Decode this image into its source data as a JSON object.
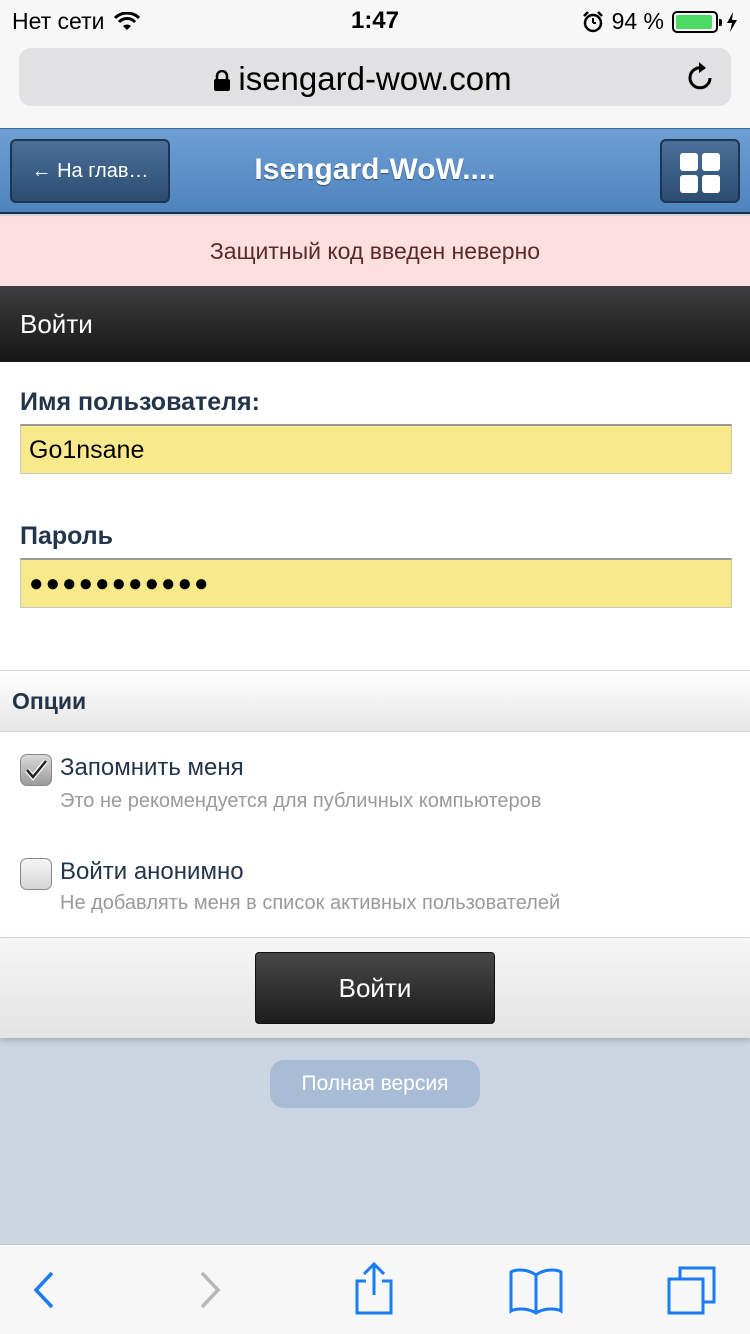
{
  "status_bar": {
    "carrier": "Нет сети",
    "time": "1:47",
    "battery_percent": "94 %",
    "battery_level": 0.94
  },
  "browser": {
    "url": "isengard-wow.com"
  },
  "header": {
    "back_label": "← На глав…",
    "title": "Isengard-WoW...."
  },
  "error_message": "Защитный код введен неверно",
  "login_bar_title": "Войти",
  "form": {
    "username_label": "Имя пользователя:",
    "username_value": "Go1nsane",
    "password_label": "Пароль",
    "password_value": "●●●●●●●●●●●"
  },
  "options": {
    "header": "Опции",
    "items": [
      {
        "label": "Запомнить меня",
        "sublabel": "Это не рекомендуется для публичных компьютеров",
        "checked": true
      },
      {
        "label": "Войти анонимно",
        "sublabel": "Не добавлять меня в список активных пользователей",
        "checked": false
      }
    ]
  },
  "submit_label": "Войти",
  "full_version_label": "Полная версия",
  "toolbar": {
    "icons": [
      "back-icon",
      "forward-icon",
      "share-icon",
      "bookmarks-icon",
      "tabs-icon"
    ]
  },
  "colors": {
    "accent": "#1a7cf5",
    "header_blue": "#5b8fc7",
    "field_yellow": "#f8ea8b",
    "error_bg": "#fddfdf"
  }
}
